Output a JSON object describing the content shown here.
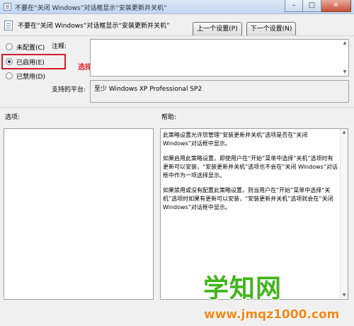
{
  "window": {
    "title": "不要在“关闭 Windows”对话框显示“安装更新并关机”",
    "controls": {
      "minimize": "–",
      "maximize": "□",
      "close": "✕"
    }
  },
  "header": {
    "setting_title": "不要在“关闭 Windows”对话框显示“安装更新并关机”",
    "prev_button": "上一个设置(P)",
    "next_button": "下一个设置(N)"
  },
  "radio_options": {
    "not_configured": "未配置(C)",
    "enabled": "已启用(E)",
    "disabled": "已禁用(D)",
    "selected": "enabled"
  },
  "annotation": "选择 已启用",
  "comment": {
    "label": "注释:",
    "value": ""
  },
  "supported_platform": {
    "label": "支持的平台:",
    "value": "至少 Windows XP Professional SP2"
  },
  "options": {
    "label": "选项:"
  },
  "help": {
    "label": "帮助:",
    "paragraphs": [
      "此策略设置允许您管理“安装更新并关机”选项是否在“关闭 Windows”对话框中显示。",
      "如果启用此策略设置，即使用户在“开始”菜单中选择“关机”选项时有更新可以安装，“安装更新并关机”选项也不会在“关闭 Windows”对话框中作为一项选择显示。",
      "如果禁用或没有配置此策略设置，则当用户在“开始”菜单中选择“关机”选项时如果有更新可以安装，“安装更新并关机”选项就会在“关闭 Windows”对话框中显示。"
    ]
  },
  "watermark": {
    "text": "学知网",
    "url": "www.jmqz1000.com"
  },
  "colors": {
    "annotation": "#e1212d",
    "highlight_border": "#d21d2c",
    "watermark": "#42b51d",
    "watermark_url": "#f0871d"
  }
}
